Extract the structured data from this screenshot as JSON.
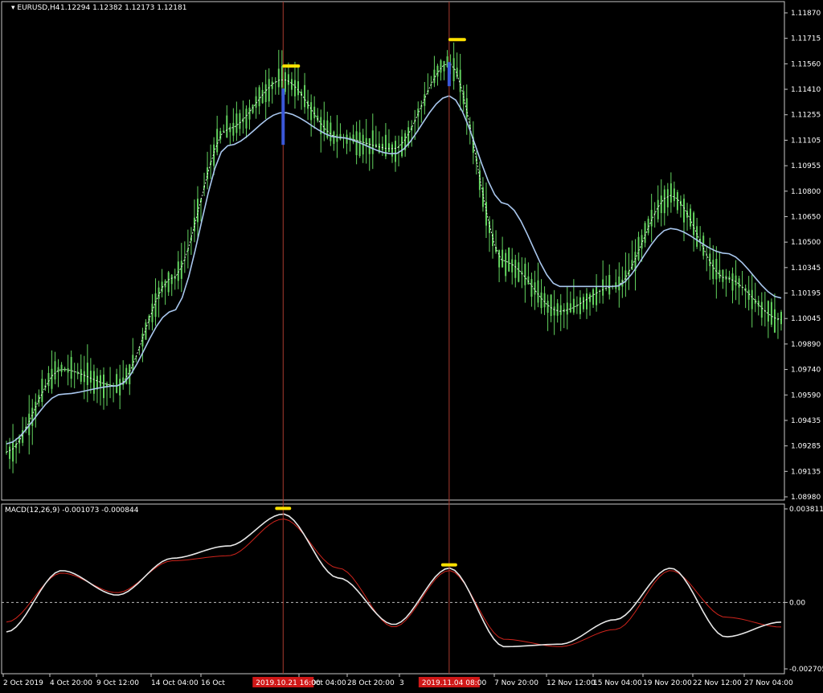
{
  "colors": {
    "background": "#000000",
    "frame": "#c8c8c8",
    "candle": "#63d45f",
    "ma_line": "#a9c7ee",
    "ma_fast": "#ffffff",
    "macd_line": "#e8e8e8",
    "signal_line": "#d0241c",
    "marker_yellow": "#ffe200",
    "marker_blue": "#3b58d8",
    "vline": "#a93a2e",
    "date_highlight": "#d01818"
  },
  "price_panel": {
    "title": "EURUSD,H4",
    "ohlc": "1.12294 1.12382 1.12173 1.12181",
    "y_ticks": [
      "1.11870",
      "1.11715",
      "1.11560",
      "1.11410",
      "1.11255",
      "1.11105",
      "1.10955",
      "1.10800",
      "1.10650",
      "1.10500",
      "1.10345",
      "1.10195",
      "1.10045",
      "1.09890",
      "1.09740",
      "1.09590",
      "1.09435",
      "1.09285",
      "1.09135",
      "1.08980"
    ]
  },
  "macd_panel": {
    "title": "MACD(12,26,9) -0.001073 -0.000844",
    "y_ticks": [
      "0.003811",
      "0.00",
      "-0.002705"
    ]
  },
  "x_axis": {
    "labels": [
      "2 Oct 2019",
      "4 Oct 20:00",
      "9 Oct 12:00",
      "14 Oct 04:00",
      "16 Oct",
      "24 Oct 04:00",
      "28 Oct 20:00",
      "3",
      "7 Nov 20:00",
      "12 Nov 12:00",
      "15 Nov 04:00",
      "19 Nov 20:00",
      "22 Nov 12:00",
      "27 Nov 04:00"
    ],
    "highlighted": [
      "2019.10.21 16:00",
      "2019.11.04 08:00"
    ]
  },
  "chart_data": [
    {
      "type": "candlestick",
      "title": "EURUSD,H4",
      "x": [
        "2 Oct 2019",
        "4 Oct 20:00",
        "9 Oct 12:00",
        "14 Oct 04:00",
        "16 Oct",
        "2019.10.21 16:00",
        "24 Oct 04:00",
        "28 Oct 20:00",
        "2019.11.04 08:00",
        "7 Nov 20:00",
        "12 Nov 12:00",
        "15 Nov 04:00",
        "19 Nov 20:00",
        "22 Nov 12:00",
        "27 Nov 04:00"
      ],
      "close": [
        1.0925,
        1.0975,
        1.0965,
        1.103,
        1.112,
        1.115,
        1.1115,
        1.1108,
        1.116,
        1.104,
        1.101,
        1.1025,
        1.108,
        1.103,
        1.1005
      ],
      "ma_slow": [
        1.093,
        1.096,
        1.0965,
        1.101,
        1.111,
        1.113,
        1.1115,
        1.1105,
        1.114,
        1.1075,
        1.1025,
        1.1025,
        1.106,
        1.1045,
        1.1018
      ],
      "ylim": [
        1.0898,
        1.1195
      ],
      "grid": false,
      "markers": [
        {
          "type": "peak",
          "x": "2019.10.21 16:00",
          "y": 1.1159
        },
        {
          "type": "peak",
          "x": "2019.11.04 08:00",
          "y": 1.1175
        }
      ]
    },
    {
      "type": "line",
      "title": "MACD(12,26,9) -0.001073 -0.000844",
      "x": [
        "2 Oct 2019",
        "4 Oct 20:00",
        "9 Oct 12:00",
        "14 Oct 04:00",
        "16 Oct",
        "2019.10.21 16:00",
        "24 Oct 04:00",
        "28 Oct 20:00",
        "2019.11.04 08:00",
        "7 Nov 20:00",
        "12 Nov 12:00",
        "15 Nov 04:00",
        "19 Nov 20:00",
        "22 Nov 12:00",
        "27 Nov 04:00"
      ],
      "series": [
        {
          "values": [
            -0.0012,
            0.0013,
            0.0003,
            0.0018,
            0.0023,
            0.0036,
            0.001,
            -0.0009,
            0.0014,
            -0.0018,
            -0.0017,
            -0.0007,
            0.0014,
            -0.0014,
            -0.0008
          ]
        },
        {
          "values": [
            -0.0008,
            0.0012,
            0.0004,
            0.0017,
            0.0019,
            0.0034,
            0.0014,
            -0.001,
            0.0013,
            -0.0015,
            -0.0018,
            -0.0011,
            0.0013,
            -0.0006,
            -0.001
          ]
        }
      ],
      "ylim": [
        -0.002705,
        0.003811
      ],
      "zero_line": true,
      "markers": [
        {
          "type": "peak",
          "x": "2019.10.21 16:00",
          "y": 0.0037
        },
        {
          "type": "peak",
          "x": "2019.11.04 08:00",
          "y": 0.0014
        }
      ]
    }
  ]
}
